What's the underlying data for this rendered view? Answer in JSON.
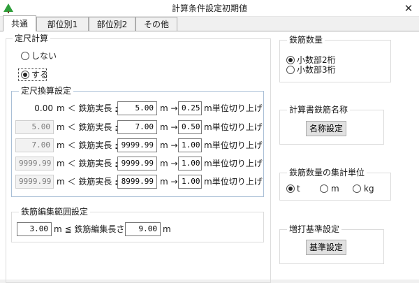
{
  "window": {
    "title": "計算条件設定初期値",
    "close_glyph": "✕"
  },
  "tabs": [
    {
      "label": "共通",
      "active": true
    },
    {
      "label": "部位別1",
      "active": false
    },
    {
      "label": "部位別2",
      "active": false
    },
    {
      "label": "その他",
      "active": false
    }
  ],
  "teishaku": {
    "title": "定尺計算",
    "options": [
      {
        "label": "しない",
        "checked": false
      },
      {
        "label": "する",
        "checked": true
      }
    ]
  },
  "kansan": {
    "title": "定尺換算設定",
    "rows": [
      {
        "lower": "0.00",
        "lower_editable": false,
        "lower_plain": true,
        "op1": "m ＜ 鉄筋実長 ≦",
        "upper": "5.00",
        "arrow": "m →",
        "round": "0.25",
        "suffix": "m単位切り上げ"
      },
      {
        "lower": "5.00",
        "lower_editable": false,
        "lower_plain": false,
        "op1": "m ＜ 鉄筋実長 ≦",
        "upper": "7.00",
        "arrow": "m →",
        "round": "0.50",
        "suffix": "m単位切り上げ"
      },
      {
        "lower": "7.00",
        "lower_editable": false,
        "lower_plain": false,
        "op1": "m ＜ 鉄筋実長 ≦",
        "upper": "9999.99",
        "arrow": "m →",
        "round": "1.00",
        "suffix": "m単位切り上げ"
      },
      {
        "lower": "9999.99",
        "lower_editable": false,
        "lower_plain": false,
        "op1": "m ＜ 鉄筋実長 ≦",
        "upper": "9999.99",
        "arrow": "m →",
        "round": "1.00",
        "suffix": "m単位切り上げ"
      },
      {
        "lower": "9999.99",
        "lower_editable": false,
        "lower_plain": false,
        "op1": "m ＜ 鉄筋実長 ≦",
        "upper": "8999.99",
        "arrow": "m →",
        "round": "1.00",
        "suffix": "m単位切り上げ"
      }
    ]
  },
  "henshu": {
    "title": "鉄筋編集範囲設定",
    "min": "3.00",
    "middle": "m ≦ 鉄筋編集長さ ≦",
    "max": "9.00",
    "unit": "m"
  },
  "suuryou": {
    "title": "鉄筋数量",
    "options": [
      {
        "label": "小数部2桁",
        "checked": true
      },
      {
        "label": "小数部3桁",
        "checked": false
      }
    ]
  },
  "meisho": {
    "title": "計算書鉄筋名称",
    "button": "名称設定"
  },
  "shuukei": {
    "title": "鉄筋数量の集計単位",
    "options": [
      {
        "label": "t",
        "checked": true
      },
      {
        "label": "m",
        "checked": false
      },
      {
        "label": "kg",
        "checked": false
      }
    ]
  },
  "mashiuchi": {
    "title": "増打基準設定",
    "button": "基準設定"
  },
  "colors": {
    "group_border_blue": "#a9bfd6",
    "app_icon_green": "#2e9e3a"
  }
}
